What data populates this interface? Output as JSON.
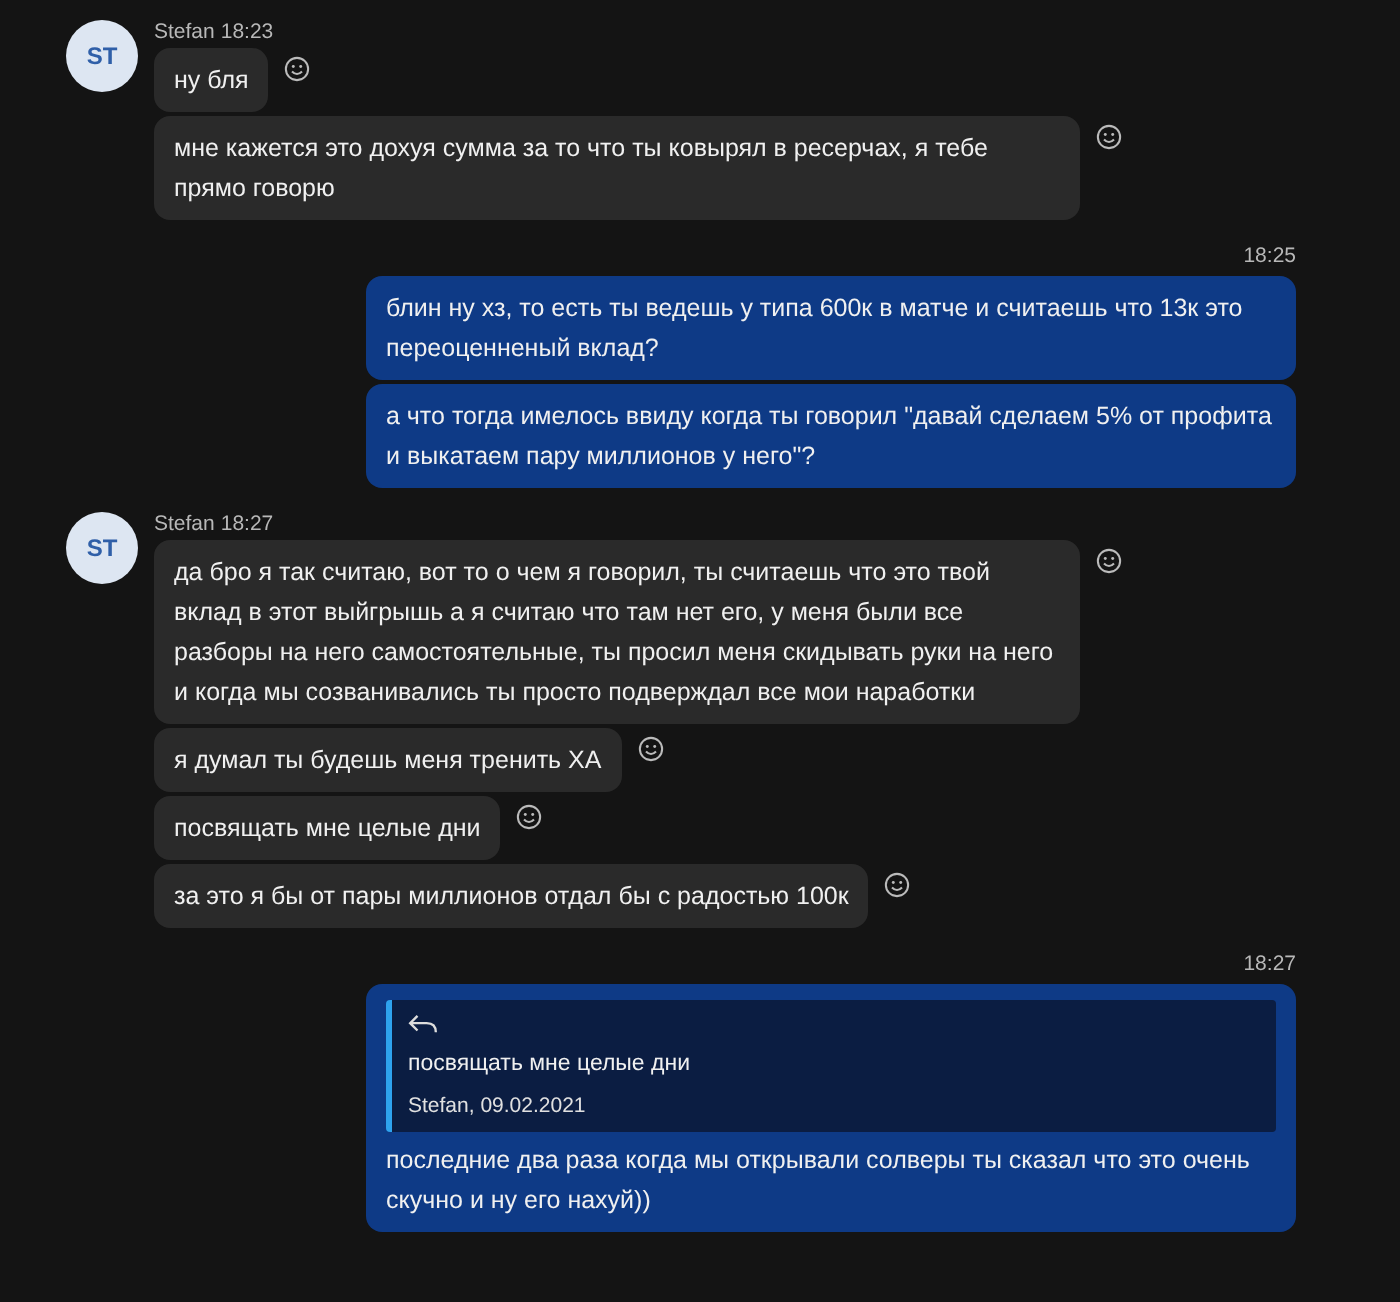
{
  "groups": [
    {
      "kind": "incoming",
      "avatar": "ST",
      "sender": "Stefan",
      "time": "18:23",
      "messages": [
        {
          "text": "ну бля"
        },
        {
          "text": "мне кажется это дохуя сумма за то что ты ковырял в ресерчах, я тебе прямо говорю"
        }
      ]
    },
    {
      "kind": "outgoing",
      "time": "18:25",
      "messages": [
        {
          "text": "блин ну хз, то есть ты ведешь у типа 600к в матче и считаешь что 13к это переоценненый вклад?"
        },
        {
          "text": "а что тогда имелось ввиду когда ты говорил \"давай сделаем 5% от профита и выкатаем пару миллионов у него\"?"
        }
      ]
    },
    {
      "kind": "incoming",
      "avatar": "ST",
      "sender": "Stefan",
      "time": "18:27",
      "messages": [
        {
          "text": "да бро я так считаю, вот то о чем я говорил, ты считаешь что это твой вклад в этот выйгрышь а я считаю что там нет его, у меня были все разборы на него самостоятельные, ты просил меня скидывать руки на него и когда мы созванивались ты просто подверждал все мои наработки"
        },
        {
          "text": "я думал ты будешь меня тренить ХА"
        },
        {
          "text": "посвящать мне целые дни"
        },
        {
          "text": "за это я бы от пары миллионов отдал бы с радостью 100к"
        }
      ]
    },
    {
      "kind": "outgoing",
      "time": "18:27",
      "messages": [
        {
          "quote": {
            "text": "посвящать мне целые дни",
            "meta": "Stefan, 09.02.2021"
          },
          "text": "последние два раза когда мы открывали солверы ты сказал что это очень скучно и ну его нахуй))"
        }
      ]
    }
  ]
}
